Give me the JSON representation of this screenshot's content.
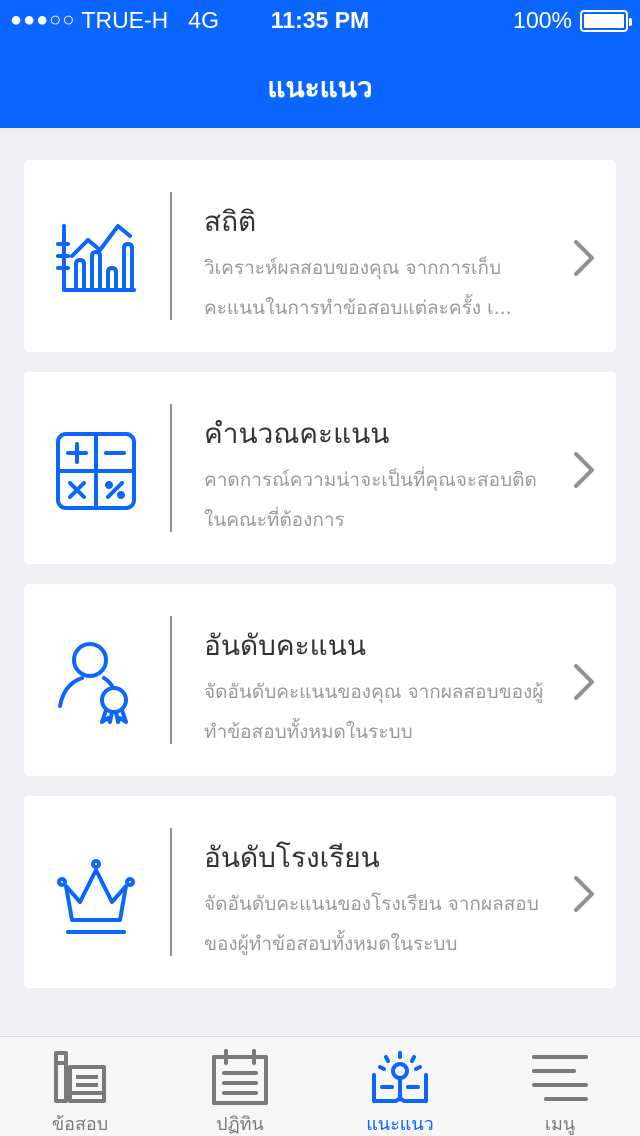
{
  "status_bar": {
    "signal": "●●●○○",
    "carrier": "TRUE-H",
    "network": "4G",
    "time": "11:35 PM",
    "battery": "100%"
  },
  "header": {
    "title": "แนะแนว"
  },
  "cards": [
    {
      "icon": "chart-icon",
      "title": "สถิติ",
      "desc": "วิเคราะห์ผลสอบของคุณ จากการเก็บคะแนนในการทำข้อสอบแต่ละครั้ง เ..."
    },
    {
      "icon": "calculator-icon",
      "title": "คำนวณคะแนน",
      "desc": "คาดการณ์ความน่าจะเป็นที่คุณจะสอบติดในคณะที่ต้องการ"
    },
    {
      "icon": "user-medal-icon",
      "title": "อันดับคะแนน",
      "desc": "จัดอันดับคะแนนของคุณ จากผลสอบของผู้ทำข้อสอบทั้งหมดในระบบ"
    },
    {
      "icon": "crown-icon",
      "title": "อันดับโรงเรียน",
      "desc": "จัดอันดับคะแนนของโรงเรียน จากผลสอบของผู้ทำข้อสอบทั้งหมดในระบบ"
    }
  ],
  "tabbar": {
    "active": "แนะแนว",
    "tabs": [
      {
        "label": "ข้อสอบ",
        "icon": "exam-books-icon"
      },
      {
        "label": "ปฏิทิน",
        "icon": "calendar-icon"
      },
      {
        "label": "แนะแนว",
        "icon": "guidance-book-icon"
      },
      {
        "label": "เมนู",
        "icon": "menu-icon"
      }
    ]
  },
  "colors": {
    "brand": "#0a66ff",
    "background": "#efeff4",
    "inactive": "#7a7a7a"
  }
}
